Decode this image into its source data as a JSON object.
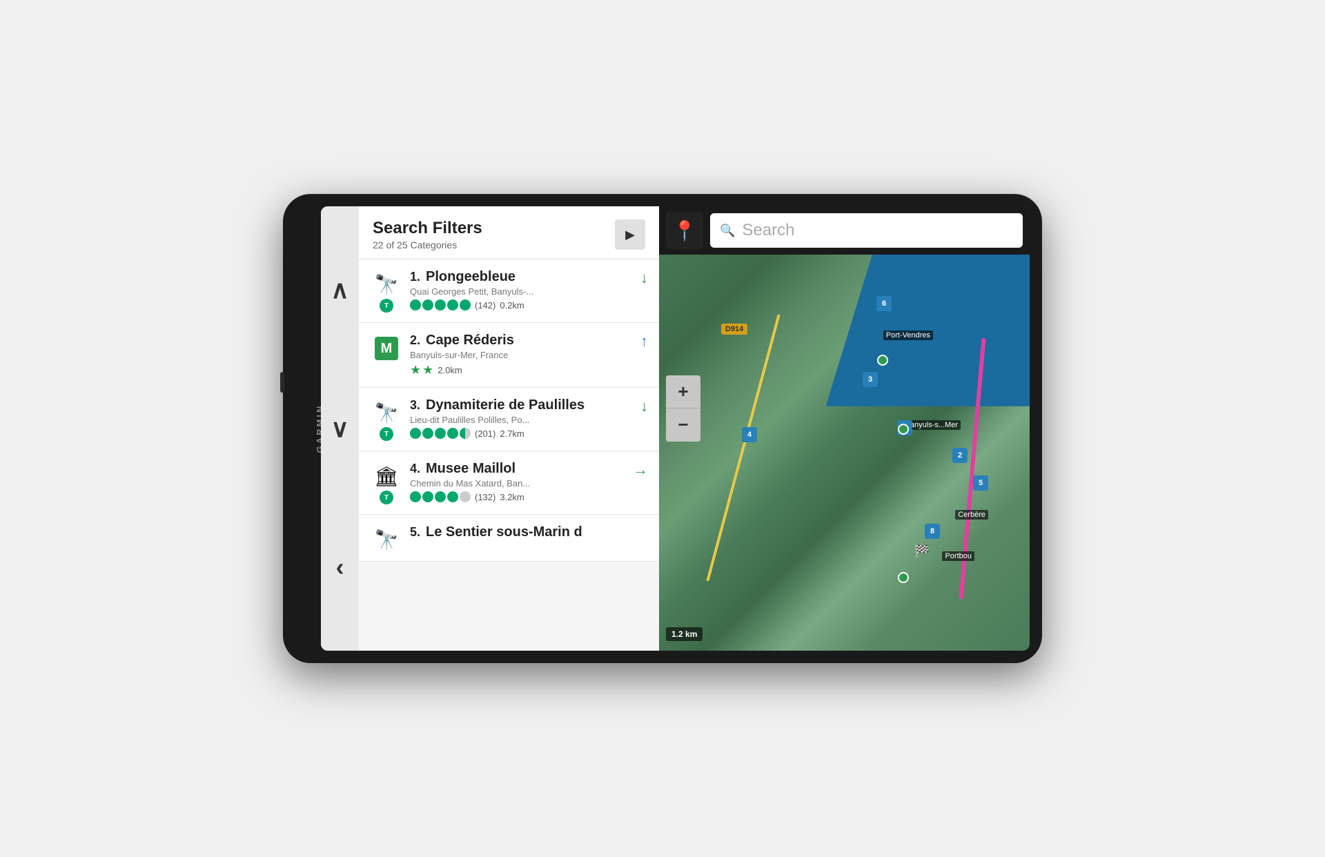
{
  "device": {
    "brand": "GARMIN"
  },
  "left_panel": {
    "header": {
      "title": "Search Filters",
      "subtitle": "22 of 25 Categories",
      "next_button_label": "▶"
    },
    "nav": {
      "up_arrow": "∧",
      "down_arrow": "∨",
      "back_arrow": "‹"
    },
    "results": [
      {
        "number": "1.",
        "name": "Plongeebleue",
        "address": "Quai Georges Petit, Banyuls-...",
        "icon_type": "binoculars",
        "rating_circles": 5,
        "rating_partial": false,
        "review_count": "(142)",
        "distance": "0.2km",
        "direction": "↓",
        "direction_color": "green"
      },
      {
        "number": "2.",
        "name": "Cape Réderis",
        "address": "Banyuls-sur-Mer, France",
        "icon_type": "michelin",
        "stars": 2,
        "rating_circles": 0,
        "review_count": "",
        "distance": "2.0km",
        "direction": "↑",
        "direction_color": "blue"
      },
      {
        "number": "3.",
        "name": "Dynamiterie de Paulilles",
        "address": "Lieu-dit Paulilles Polilles, Po...",
        "icon_type": "binoculars",
        "rating_circles": 4,
        "rating_partial": true,
        "review_count": "(201)",
        "distance": "2.7km",
        "direction": "↓",
        "direction_color": "green"
      },
      {
        "number": "4.",
        "name": "Musee Maillol",
        "address": "Chemin du Mas Xatard, Ban...",
        "icon_type": "museum",
        "rating_circles": 4,
        "rating_partial": false,
        "review_count": "(132)",
        "distance": "3.2km",
        "direction": "→",
        "direction_color": "green"
      },
      {
        "number": "5.",
        "name": "Le Sentier sous-Marin d",
        "address": "",
        "icon_type": "binoculars",
        "rating_circles": 0,
        "review_count": "",
        "distance": "",
        "direction": ""
      }
    ]
  },
  "map": {
    "search_placeholder": "Search",
    "zoom_in": "+",
    "zoom_out": "−",
    "scale": "1.2 km",
    "road_label": "D914",
    "place_labels": [
      "Port-Vendres",
      "Banyuls-s...Mer",
      "Cerbère",
      "Portbou"
    ],
    "number_pins": [
      "1",
      "2",
      "3",
      "4",
      "5",
      "6",
      "8"
    ]
  }
}
